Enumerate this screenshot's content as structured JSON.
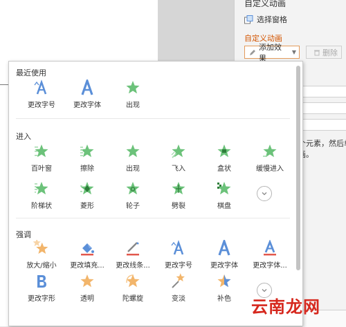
{
  "pane": {
    "title": "自定义动画",
    "select_pane": "选择窗格",
    "custom_animation": "自定义动画",
    "add_effect": "添加效果",
    "delete": "删除",
    "hint_line1": "个元素，然后单",
    "hint_line2": "画。"
  },
  "colors": {
    "accent_orange": "#d35400",
    "star_green": "#6cc27a",
    "icon_blue": "#5b8fd8",
    "star_orange": "#f2b56b"
  },
  "popup": {
    "sections": [
      {
        "title": "最近使用",
        "items": [
          {
            "label": "更改字号",
            "icon": "font-size-icon"
          },
          {
            "label": "更改字体",
            "icon": "font-icon"
          },
          {
            "label": "出现",
            "icon": "appear-star-icon"
          }
        ]
      },
      {
        "title": "进入",
        "items": [
          {
            "label": "百叶窗",
            "icon": "blinds-star-icon"
          },
          {
            "label": "擦除",
            "icon": "wipe-star-icon"
          },
          {
            "label": "出现",
            "icon": "appear-star-icon"
          },
          {
            "label": "飞入",
            "icon": "fly-in-star-icon"
          },
          {
            "label": "盒状",
            "icon": "box-star-icon"
          },
          {
            "label": "缓慢进入",
            "icon": "crawl-in-star-icon"
          },
          {
            "label": "阶梯状",
            "icon": "checkerboard-star-icon"
          },
          {
            "label": "菱形",
            "icon": "diamond-star-icon"
          },
          {
            "label": "轮子",
            "icon": "wheel-star-icon"
          },
          {
            "label": "劈裂",
            "icon": "split-star-icon"
          },
          {
            "label": "棋盘",
            "icon": "chessboard-star-icon"
          }
        ]
      },
      {
        "title": "强调",
        "items": [
          {
            "label": "放大/缩小",
            "icon": "grow-shrink-star-icon"
          },
          {
            "label": "更改填充...",
            "icon": "fill-color-icon"
          },
          {
            "label": "更改线条...",
            "icon": "line-color-icon"
          },
          {
            "label": "更改字号",
            "icon": "font-size-icon"
          },
          {
            "label": "更改字体",
            "icon": "font-icon"
          },
          {
            "label": "更改字体...",
            "icon": "font-color-icon"
          },
          {
            "label": "更改字形",
            "icon": "font-style-icon"
          },
          {
            "label": "透明",
            "icon": "transparency-star-icon"
          },
          {
            "label": "陀螺旋",
            "icon": "spin-star-icon"
          },
          {
            "label": "变淡",
            "icon": "fade-star-icon"
          },
          {
            "label": "补色",
            "icon": "complementary-color-star-icon"
          }
        ]
      }
    ]
  },
  "watermark": "云南龙网"
}
